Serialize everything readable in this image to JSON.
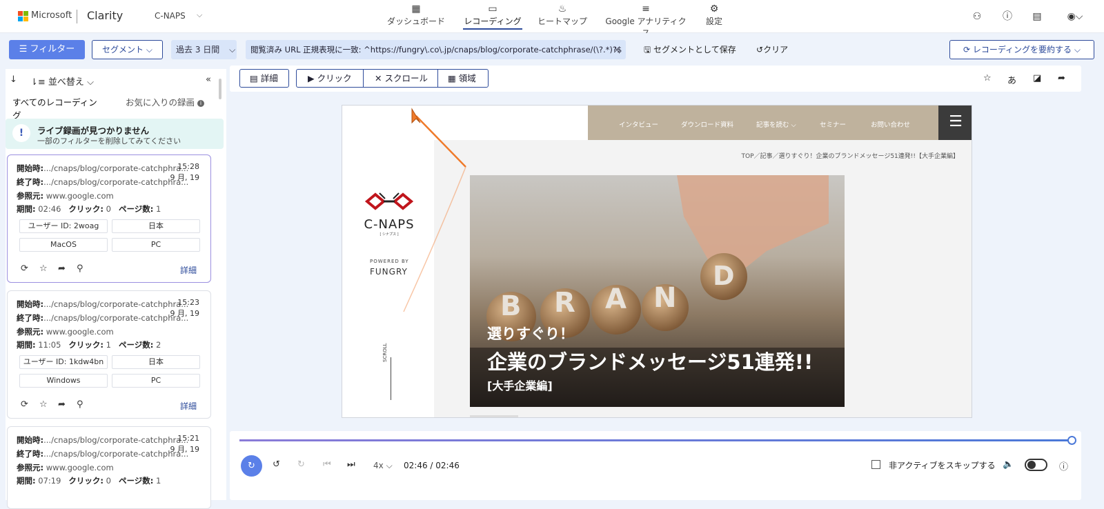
{
  "header": {
    "ms_label": "Microsoft",
    "app_name": "Clarity",
    "project": "C-NAPS",
    "nav": [
      {
        "label": "ダッシュボード",
        "icon": "▦"
      },
      {
        "label": "レコーディング",
        "icon": "▭"
      },
      {
        "label": "ヒートマップ",
        "icon": "♨"
      },
      {
        "label": "Google アナリティクス",
        "icon": "≡"
      },
      {
        "label": "設定",
        "icon": "⚙"
      }
    ],
    "active_nav": "レコーディング"
  },
  "filters": {
    "filter_label": "フィルター",
    "segment_label": "セグメント",
    "date_range": "過去 3 日間",
    "url_filter": "閲覧済み URL 正規表現に一致: ^https://fungry\\.co\\.jp/cnaps/blog/corporate-catchphrase/(\\?.*)?$",
    "save_segment": "セグメントとして保存",
    "clear": "クリア",
    "summarize": "レコーディングを要約する"
  },
  "sidebar": {
    "sort_label": "並べ替え",
    "tabs": [
      "すべてのレコーディング",
      "お気に入りの録画"
    ],
    "notice_title": "ライブ録画が見つかりません",
    "notice_sub": "一部のフィルターを削除してみてください",
    "labels": {
      "start": "開始時:",
      "end": "終了時:",
      "ref": "参照元:",
      "duration": "期間:",
      "clicks": "クリック:",
      "pages": "ページ数:",
      "detail": "詳細"
    },
    "recordings": [
      {
        "start": ".../cnaps/blog/corporate-catchphra...",
        "end": ".../cnaps/blog/corporate-catchphra...",
        "ref": "www.google.com",
        "time": "15:28",
        "date": "9 月, 19",
        "duration": "02:46",
        "clicks": "0",
        "pages": "1",
        "user": "ユーザー ID: 2woag",
        "country": "日本",
        "os": "MacOS",
        "device": "PC"
      },
      {
        "start": ".../cnaps/blog/corporate-catchphra...",
        "end": ".../cnaps/blog/corporate-catchphra...",
        "ref": "www.google.com",
        "time": "15:23",
        "date": "9 月, 19",
        "duration": "11:05",
        "clicks": "1",
        "pages": "2",
        "user": "ユーザー ID: 1kdw4bn",
        "country": "日本",
        "os": "Windows",
        "device": "PC"
      },
      {
        "start": ".../cnaps/blog/corporate-catchphra...",
        "end": ".../cnaps/blog/corporate-catchphra...",
        "ref": "www.google.com",
        "time": "15:21",
        "date": "9 月, 19",
        "duration": "07:19",
        "clicks": "0",
        "pages": "1"
      }
    ]
  },
  "toolbar": {
    "detail": "詳細",
    "click": "クリック",
    "scroll": "スクロール",
    "area": "領域"
  },
  "viewport": {
    "nav": [
      "インタビュー",
      "ダウンロード資料",
      "記事を読む ⌵",
      "セミナー",
      "お問い合わせ"
    ],
    "breadcrumb": "TOP／記事／選りすぐり！企業のブランドメッセージ51連発!!【大手企業編】",
    "logo": "C-NAPS",
    "logo_sub": "[ シナプス ]",
    "powered": "POWERED BY",
    "fungry": "FUNGRY",
    "scroll": "SCROLL",
    "hero_small": "選りすぐり！",
    "hero_big": "企業のブランドメッセージ51連発!!",
    "hero_sub": "[大手企業編]",
    "brand_letters": [
      "B",
      "R",
      "A",
      "N",
      "D"
    ]
  },
  "player": {
    "progress": 1.0,
    "speed": "4x",
    "time": "02:46 / 02:46",
    "skip_label": "非アクティブをスキップする"
  },
  "colors": {
    "accent": "#5b80e8",
    "navy": "#2c4a9a",
    "notice_bg": "#e3f5f4",
    "site_nav": "#bfb29d"
  }
}
